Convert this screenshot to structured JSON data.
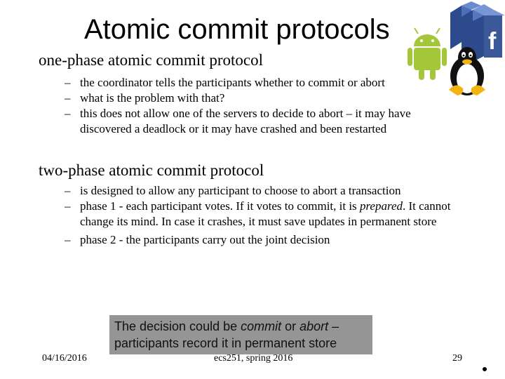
{
  "slide": {
    "title": "Atomic commit protocols",
    "sections": [
      {
        "heading": "one-phase atomic commit protocol",
        "bullets": [
          "the coordinator tells the participants whether to commit or abort",
          "what is the problem with that?",
          "this does not allow one of the servers to decide to abort – it may have discovered a deadlock or it may have crashed and been restarted"
        ]
      },
      {
        "heading": "two-phase atomic commit protocol",
        "bullets": [
          "is designed to allow any participant to choose to abort a transaction",
          {
            "before": "phase 1 - each participant votes. If it votes to commit, it is ",
            "italic": "prepared",
            "after": ". It cannot change its mind. In case it crashes, it must save updates in permanent store"
          },
          "phase 2 - the participants carry out the joint decision"
        ]
      }
    ],
    "callout": {
      "line1_prefix": "The decision could be ",
      "line1_italic1": "commit",
      "line1_mid": " or ",
      "line1_italic2": "abort",
      "line1_suffix": " –",
      "line2": "participants record it in permanent store",
      "background": "#959595"
    },
    "dash": "–",
    "footer": {
      "date": "04/16/2016",
      "course": "ecs251, spring 2016",
      "page": "29"
    },
    "logos": [
      "android-icon",
      "tux-linux-icon",
      "facebook-icon"
    ],
    "colors": {
      "android_green": "#a4c639",
      "facebook_blue": "#3b5998",
      "tux_yellow": "#f2b50f"
    }
  }
}
